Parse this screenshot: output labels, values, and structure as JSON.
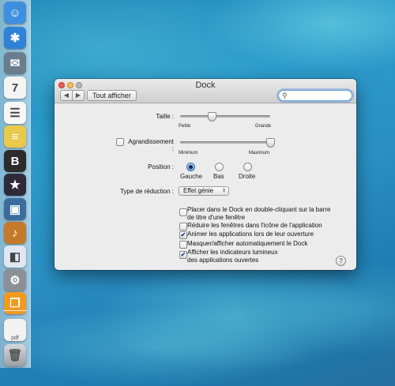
{
  "window": {
    "title": "Dock"
  },
  "toolbar": {
    "back_glyph": "◀",
    "forward_glyph": "▶",
    "show_all_label": "Tout afficher",
    "search_placeholder": "",
    "search_value": ""
  },
  "size": {
    "label": "Taille :",
    "min_label": "Petite",
    "max_label": "Grande",
    "value": 0.35
  },
  "magnification": {
    "label": "Agrandissement :",
    "checked": false,
    "min_label": "Minimum",
    "max_label": "Maximum",
    "value": 1.0
  },
  "position": {
    "label": "Position :",
    "options": [
      {
        "label": "Gauche",
        "selected": true
      },
      {
        "label": "Bas",
        "selected": false
      },
      {
        "label": "Droite",
        "selected": false
      }
    ]
  },
  "minimize": {
    "label": "Type de réduction :",
    "selected": "Effet génie"
  },
  "options": [
    {
      "line1": "Placer dans le Dock en double-cliquant sur la barre",
      "line2": "de titre d'une fenêtre",
      "checked": false,
      "mark": ""
    },
    {
      "line1": "Réduire les fenêtres dans l'icône de l'application",
      "checked": false,
      "mark": ""
    },
    {
      "line1": "Animer les applications lors de leur ouverture",
      "checked": true,
      "mark": "✔"
    },
    {
      "line1": "Masquer/afficher automatiquement le Dock",
      "checked": false,
      "mark": ""
    },
    {
      "line1": "Afficher les indicateurs lumineux",
      "line2": "des applications ouvertes",
      "checked": true,
      "mark": "✔"
    }
  ],
  "help_label": "?",
  "dock": {
    "items": [
      {
        "name": "finder",
        "color": "#3f8fe0",
        "glyph": "☺"
      },
      {
        "name": "safari",
        "color": "#2f82d6",
        "glyph": "✱"
      },
      {
        "name": "mail",
        "color": "#6a7d8f",
        "glyph": "✉"
      },
      {
        "name": "calendar",
        "color": "#f4f4f4",
        "glyph": "7"
      },
      {
        "name": "reminders",
        "color": "#f7f7f7",
        "glyph": "☰"
      },
      {
        "name": "notes",
        "color": "#e8c94a",
        "glyph": "≡"
      },
      {
        "name": "app-b",
        "color": "#2c2c2c",
        "glyph": "B"
      },
      {
        "name": "imovie",
        "color": "#2e2a3a",
        "glyph": "★"
      },
      {
        "name": "iphoto",
        "color": "#3c6c9c",
        "glyph": "▣"
      },
      {
        "name": "garageband",
        "color": "#c47a2a",
        "glyph": "♪"
      },
      {
        "name": "preview",
        "color": "#dfe7f2",
        "glyph": "◧"
      },
      {
        "name": "system-preferences",
        "color": "#8b8f96",
        "glyph": "⚙"
      },
      {
        "name": "ibooks",
        "color": "#f29a1e",
        "glyph": "❐"
      }
    ],
    "doc_label": "pdf",
    "trash_glyph": "🗑"
  }
}
